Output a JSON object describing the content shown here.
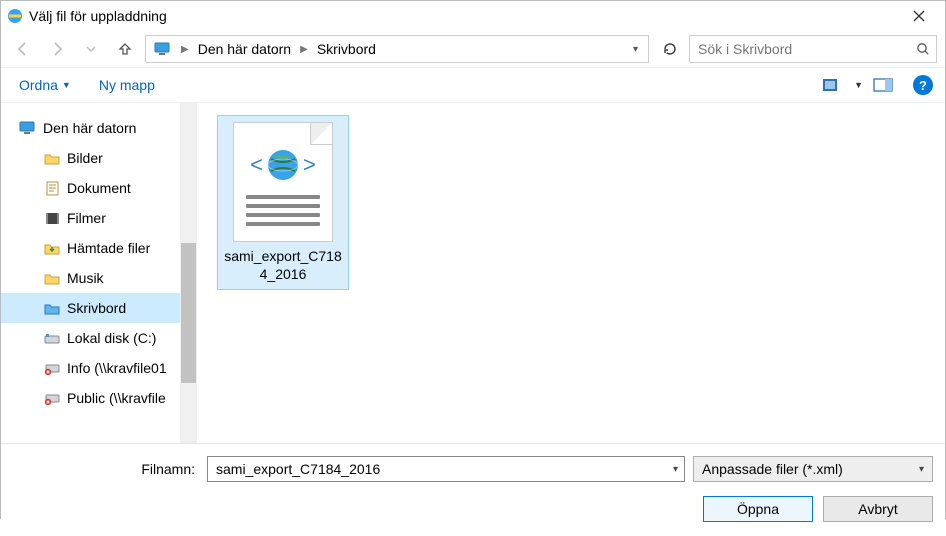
{
  "window": {
    "title": "Välj fil för uppladdning"
  },
  "breadcrumb": {
    "root": "Den här datorn",
    "current": "Skrivbord"
  },
  "search": {
    "placeholder": "Sök i Skrivbord"
  },
  "toolbar": {
    "organize": "Ordna",
    "new_folder": "Ny mapp"
  },
  "tree": {
    "root": "Den här datorn",
    "items": [
      {
        "label": "Bilder"
      },
      {
        "label": "Dokument"
      },
      {
        "label": "Filmer"
      },
      {
        "label": "Hämtade filer"
      },
      {
        "label": "Musik"
      },
      {
        "label": "Skrivbord",
        "selected": true
      },
      {
        "label": "Lokal disk (C:)"
      },
      {
        "label": "Info (\\\\kravfile01"
      },
      {
        "label": "Public (\\\\kravfile"
      }
    ]
  },
  "files": [
    {
      "name": "sami_export_C7184_2016",
      "selected": true
    }
  ],
  "footer": {
    "filename_label": "Filnamn:",
    "filename_value": "sami_export_C7184_2016",
    "filter_label": "Anpassade filer (*.xml)",
    "open_label": "Öppna",
    "cancel_label": "Avbryt"
  }
}
